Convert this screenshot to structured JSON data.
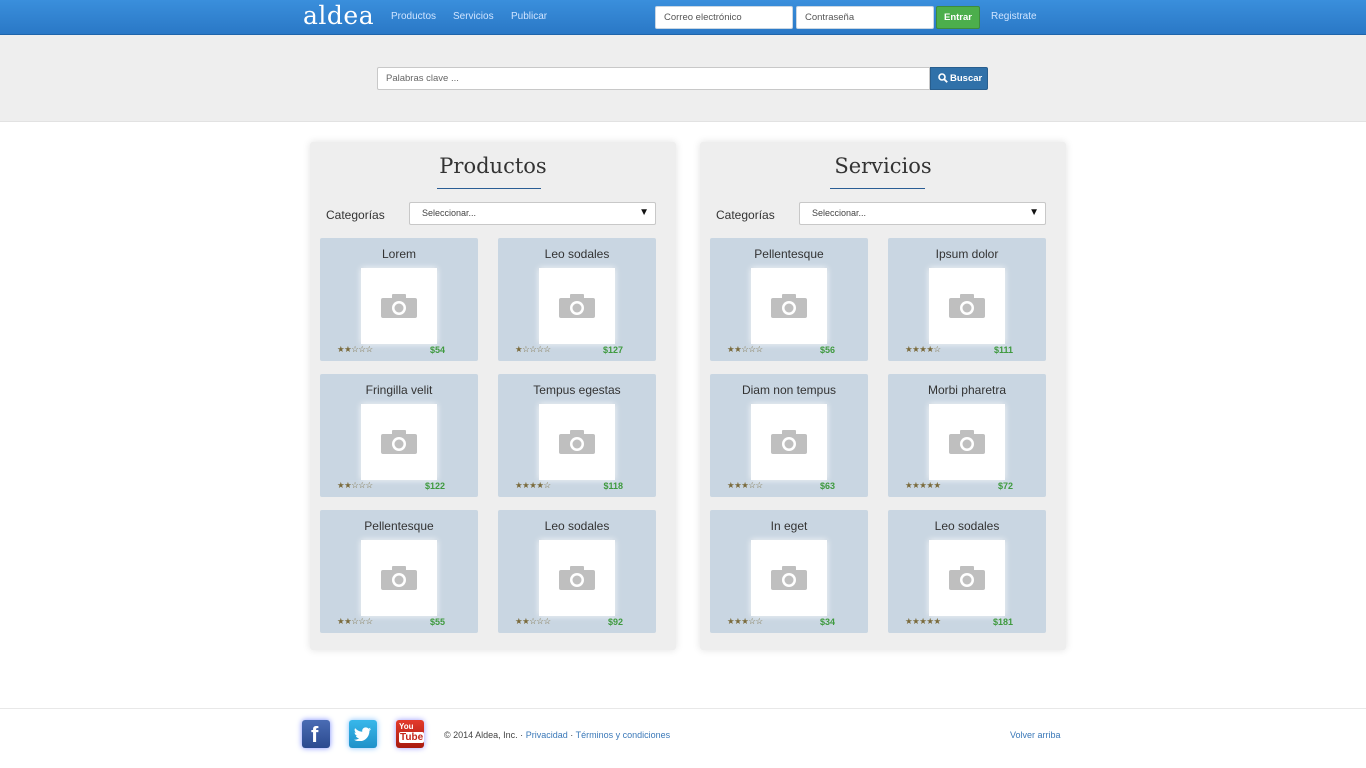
{
  "nav": {
    "brand": "aldea",
    "links": [
      "Productos",
      "Servicios",
      "Publicar"
    ],
    "email_placeholder": "Correo electrónico",
    "password_placeholder": "Contraseña",
    "login_label": "Entrar",
    "register_label": "Registrate"
  },
  "search": {
    "placeholder": "Palabras clave ...",
    "button_label": "Buscar"
  },
  "panels": [
    {
      "title": "Productos",
      "category_label": "Categorías",
      "category_value": "Seleccionar...",
      "items": [
        {
          "title": "Lorem",
          "rating": 2,
          "price": "$54"
        },
        {
          "title": "Leo sodales",
          "rating": 1,
          "price": "$127"
        },
        {
          "title": "Fringilla velit",
          "rating": 2,
          "price": "$122"
        },
        {
          "title": "Tempus egestas",
          "rating": 4,
          "price": "$118"
        },
        {
          "title": "Pellentesque",
          "rating": 2,
          "price": "$55"
        },
        {
          "title": "Leo sodales",
          "rating": 2,
          "price": "$92"
        }
      ]
    },
    {
      "title": "Servicios",
      "category_label": "Categorías",
      "category_value": "Seleccionar...",
      "items": [
        {
          "title": "Pellentesque",
          "rating": 2,
          "price": "$56"
        },
        {
          "title": "Ipsum dolor",
          "rating": 4,
          "price": "$111"
        },
        {
          "title": "Diam non tempus",
          "rating": 3,
          "price": "$63"
        },
        {
          "title": "Morbi pharetra",
          "rating": 5,
          "price": "$72"
        },
        {
          "title": "In eget",
          "rating": 3,
          "price": "$34"
        },
        {
          "title": "Leo sodales",
          "rating": 5,
          "price": "$181"
        }
      ]
    }
  ],
  "footer": {
    "social": [
      "facebook-icon",
      "twitter-icon",
      "youtube-icon"
    ],
    "copyright": "© 2014 Aldea, Inc. ·",
    "privacy": "Privacidad",
    "separator": "·",
    "terms": "Términos y condiciones",
    "back_to_top": "Volver arriba"
  },
  "colors": {
    "navbar": "#2a78c6",
    "login_button": "#4cae4c",
    "search_button": "#3071a9",
    "card_background": "#c9d6e2",
    "price": "#3f9a3f",
    "link": "#3a78b8"
  }
}
